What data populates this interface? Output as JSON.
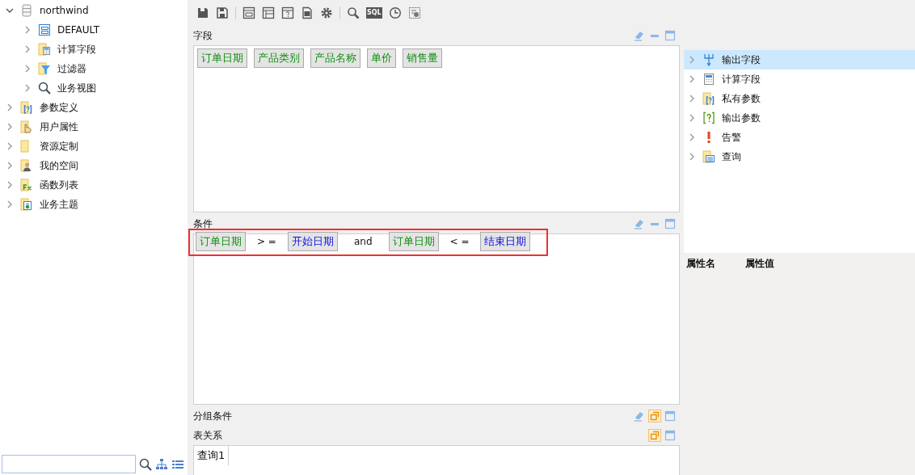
{
  "toolbar": {
    "sql_label": "SQL"
  },
  "left_tree": [
    {
      "label": "northwind",
      "expanded": true,
      "children": [
        {
          "label": "DEFAULT",
          "expanded": false
        },
        {
          "label": "计算字段",
          "expanded": false
        },
        {
          "label": "过滤器",
          "expanded": false
        },
        {
          "label": "业务视图",
          "expanded": false
        }
      ]
    },
    {
      "label": "参数定义",
      "expanded": false
    },
    {
      "label": "用户属性",
      "expanded": false
    },
    {
      "label": "资源定制",
      "expanded": false
    },
    {
      "label": "我的空间",
      "expanded": false
    },
    {
      "label": "函数列表",
      "expanded": false
    },
    {
      "label": "业务主题",
      "expanded": false
    }
  ],
  "sections": [
    {
      "title": "字段",
      "collapsed": false,
      "fields": [
        "订单日期",
        "产品类别",
        "产品名称",
        "单价",
        "销售量"
      ]
    },
    {
      "title": "条件",
      "collapsed": false,
      "highlighted": true,
      "tokens": [
        {
          "kind": "field",
          "text": "订单日期"
        },
        {
          "kind": "operator",
          "text": "> ="
        },
        {
          "kind": "param",
          "text": "开始日期"
        },
        {
          "kind": "keyword",
          "text": "and"
        },
        {
          "kind": "field",
          "text": "订单日期"
        },
        {
          "kind": "operator",
          "text": "< ="
        },
        {
          "kind": "param",
          "text": "结束日期"
        }
      ]
    },
    {
      "title": "分组条件",
      "collapsed": true
    },
    {
      "title": "表关系",
      "collapsed": true
    }
  ],
  "query_tabs": [
    {
      "label": "查询1",
      "selected": true
    }
  ],
  "right_tree": [
    {
      "label": "输出字段",
      "selected": true,
      "expanded": false
    },
    {
      "label": "计算字段",
      "selected": false,
      "expanded": false
    },
    {
      "label": "私有参数",
      "selected": false,
      "expanded": false
    },
    {
      "label": "输出参数",
      "selected": false,
      "expanded": false
    },
    {
      "label": "告警",
      "selected": false,
      "expanded": false
    },
    {
      "label": "查询",
      "selected": false,
      "expanded": false
    }
  ],
  "properties": {
    "columns": [
      "属性名",
      "属性值"
    ]
  }
}
